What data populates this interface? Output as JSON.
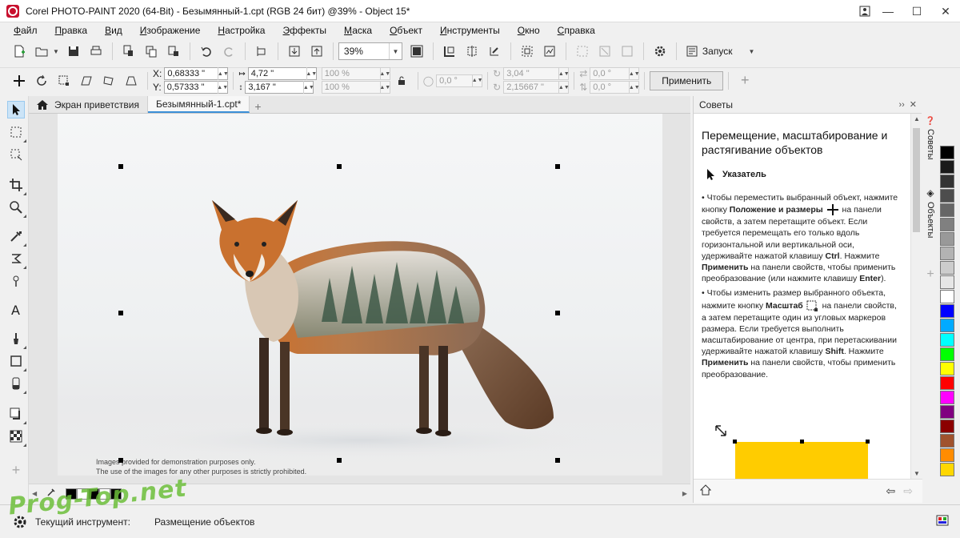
{
  "window": {
    "title": "Corel PHOTO-PAINT 2020 (64-Bit) - Безымянный-1.cpt (RGB 24 бит) @39% - Object 15*"
  },
  "menu": [
    "Файл",
    "Правка",
    "Вид",
    "Изображение",
    "Настройка",
    "Эффекты",
    "Маска",
    "Объект",
    "Инструменты",
    "Окно",
    "Справка"
  ],
  "standard_toolbar": {
    "zoom_value": "39%",
    "launch_label": "Запуск"
  },
  "property_bar": {
    "x_label": "X:",
    "x_value": "0,68333 \"",
    "y_label": "Y:",
    "y_value": "0,57333 \"",
    "width_value": "4,72 \"",
    "height_value": "3,167 \"",
    "scale_w": "100 %",
    "scale_h": "100 %",
    "angle_value": "0,0 °",
    "center_x": "3,04 \"",
    "center_y": "2,15667 \"",
    "skew_h": "0,0 °",
    "skew_v": "0,0 °",
    "apply_label": "Применить"
  },
  "doc_tabs": [
    {
      "label": "Экран приветствия",
      "active": false
    },
    {
      "label": "Безымянный-1.cpt*",
      "active": true
    }
  ],
  "canvas": {
    "caption_line1": "Images provided for demonstration purposes only.",
    "caption_line2": "The use of the images for any other purposes is strictly prohibited."
  },
  "docker": {
    "header": "Советы",
    "title": "Перемещение, масштабирование и растягивание объектов",
    "tool_name": "Указатель",
    "tip1_a": "Чтобы переместить выбранный объект, нажмите кнопку ",
    "tip1_b": "Положение и размеры",
    "tip1_c": " на панели свойств, а затем перетащите объект. Если требуется перемещать его только вдоль горизонтальной или вертикальной оси, удерживайте нажатой клавишу ",
    "tip1_d": "Ctrl",
    "tip1_e": ". Нажмите ",
    "tip1_f": "Применить",
    "tip1_g": " на панели свойств, чтобы применить преобразование (или нажмите клавишу ",
    "tip1_h": "Enter",
    "tip1_i": ").",
    "tip2_a": "Чтобы изменить размер выбранного объекта, нажмите кнопку ",
    "tip2_b": "Масштаб",
    "tip2_c": " на панели свойств, а затем перетащите один из угловых маркеров размера. Если требуется выполнить масштабирование от центра, при перетаскивании удерживайте нажатой клавишу ",
    "tip2_d": "Shift",
    "tip2_e": ". Нажмите ",
    "tip2_f": "Применить",
    "tip2_g": " на панели свойств, чтобы применить преобразование."
  },
  "vertical_tabs": [
    "Советы",
    "Объекты"
  ],
  "palette": [
    "#000000",
    "#1a1a1a",
    "#333333",
    "#4d4d4d",
    "#666666",
    "#808080",
    "#999999",
    "#b3b3b3",
    "#cccccc",
    "#e6e6e6",
    "#ffffff",
    "#0000ff",
    "#00aaff",
    "#00ffff",
    "#00ff00",
    "#ffff00",
    "#ff0000",
    "#ff00ff",
    "#800080",
    "#8b0000",
    "#a0522d",
    "#ff8c00",
    "#ffd700"
  ],
  "status": {
    "label": "Текущий инструмент:",
    "value": "Размещение объектов"
  },
  "watermark": "Prog-Top.net",
  "colors": {
    "accent": "#3b8fd8",
    "brand": "#c8102e",
    "sample_yellow": "#ffcc00"
  }
}
